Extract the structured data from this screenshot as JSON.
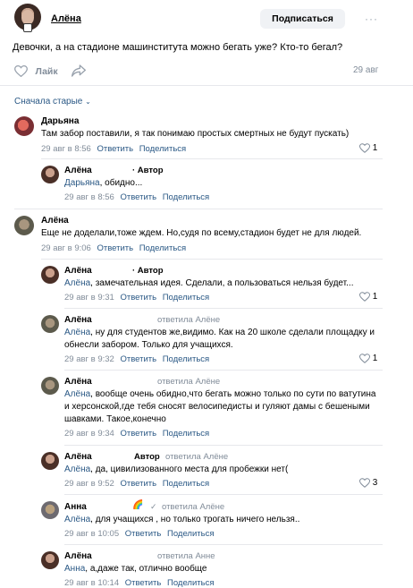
{
  "post": {
    "author": "Алёна",
    "subscribe_label": "Подписаться",
    "more_label": "···",
    "text": "Девочки, а на стадионе машинститута можно бегать уже? Кто-то бегал?",
    "like_label": "Лайк",
    "date": "29 авг"
  },
  "sort": {
    "label": "Сначала старые"
  },
  "comments": [
    {
      "author": "Дарьяна",
      "text": "Там забор поставили, я так понимаю простых смертных не будут пускать)",
      "date": "29 авг в 8:56",
      "reply": "Ответить",
      "share": "Поделиться",
      "likes": "1"
    },
    {
      "author": "Алёна",
      "author_tag": "· Автор",
      "mention": "Дарьяна",
      "text": ", обидно...",
      "date": "29 авг в 8:56",
      "reply": "Ответить",
      "share": "Поделиться"
    },
    {
      "author": "Алёна",
      "text": "Еще не доделали,тоже ждем. Но,судя по всему,стадион будет не для людей.",
      "date": "29 авг в 9:06",
      "reply": "Ответить",
      "share": "Поделиться"
    },
    {
      "author": "Алёна",
      "author_tag": "· Автор",
      "mention": "Алёна",
      "text": ", замечательная идея. Сделали, а пользоваться нельзя будет...",
      "date": "29 авг в 9:31",
      "reply": "Ответить",
      "share": "Поделиться",
      "likes": "1"
    },
    {
      "author": "Алёна",
      "replied": "ответила Алёне",
      "mention": "Алёна",
      "text": ", ну для студентов же,видимо. Как на 20 школе сделали площадку и обнесли забором. Только для учащихся.",
      "date": "29 авг в 9:32",
      "reply": "Ответить",
      "share": "Поделиться",
      "likes": "1"
    },
    {
      "author": "Алёна",
      "replied": "ответила Алёне",
      "mention": "Алёна",
      "text": ", вообще очень обидно,что бегать можно только по сути по ватутина и херсонской,где тебя сносят велосипедисты и гуляют дамы с бешеными шавками. Такое,конечно",
      "date": "29 авг в 9:34",
      "reply": "Ответить",
      "share": "Поделиться"
    },
    {
      "author": "Алёна",
      "author_tag": "Автор",
      "replied": "ответила Алёне",
      "mention": "Алёна",
      "text": ", да, цивилизованного места для пробежки нет(",
      "date": "29 авг в 9:52",
      "reply": "Ответить",
      "share": "Поделиться",
      "likes": "3"
    },
    {
      "author": "Анна",
      "emoji": "🌈",
      "replied": "ответила Алёне",
      "mention": "Алёна",
      "text": ", для учащихся , но только трогать ничего нельзя..",
      "date": "29 авг в 10:05",
      "reply": "Ответить",
      "share": "Поделиться"
    },
    {
      "author": "Алёна",
      "replied": "ответила Анне",
      "mention": "Анна",
      "text": ", а,даже так, отлично вообще",
      "date": "29 авг в 10:14",
      "reply": "Ответить",
      "share": "Поделиться"
    }
  ],
  "colors": {
    "link": "#2a5885",
    "meta": "#818c99",
    "button_bg": "#f0f2f5"
  }
}
